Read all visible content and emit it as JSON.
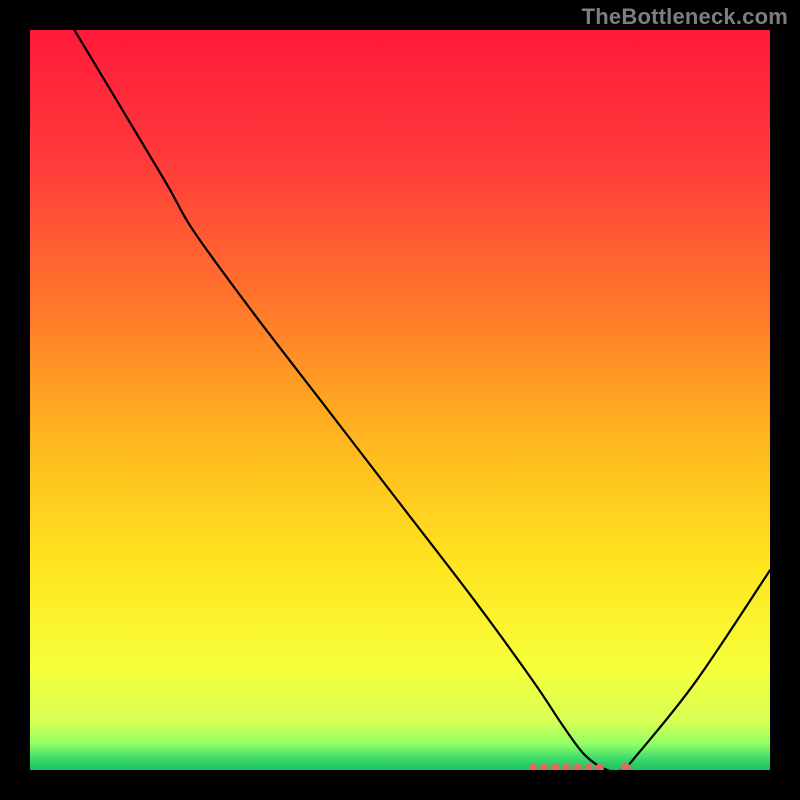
{
  "watermark": "TheBottleneck.com",
  "chart_data": {
    "type": "line",
    "title": "",
    "xlabel": "",
    "ylabel": "",
    "xlim": [
      0,
      100
    ],
    "ylim": [
      0,
      100
    ],
    "series": [
      {
        "name": "bottleneck-curve",
        "x": [
          0,
          6,
          18,
          22,
          30,
          40,
          50,
          60,
          68,
          72,
          75,
          78,
          80,
          82,
          90,
          100
        ],
        "y": [
          110,
          100,
          80,
          73,
          62,
          49,
          36,
          23,
          12,
          6,
          2,
          0,
          0,
          2,
          12,
          27
        ]
      }
    ],
    "markers": {
      "name": "optimal-range-dots",
      "x": [
        68.0,
        69.5,
        71.0,
        72.5,
        74.0,
        75.5,
        77.0,
        80.5
      ],
      "y": [
        0.3,
        0.3,
        0.3,
        0.3,
        0.3,
        0.3,
        0.3,
        0.3
      ]
    },
    "gradient_bands": [
      {
        "stop": 0.0,
        "color": "#ff1a3a"
      },
      {
        "stop": 0.18,
        "color": "#ff3b3b"
      },
      {
        "stop": 0.38,
        "color": "#ff7a2a"
      },
      {
        "stop": 0.55,
        "color": "#ffb51f"
      },
      {
        "stop": 0.72,
        "color": "#ffe41f"
      },
      {
        "stop": 0.86,
        "color": "#f6ff3a"
      },
      {
        "stop": 0.935,
        "color": "#d7ff55"
      },
      {
        "stop": 0.965,
        "color": "#8fff66"
      },
      {
        "stop": 0.985,
        "color": "#3bd96b"
      },
      {
        "stop": 1.0,
        "color": "#1fbf63"
      }
    ],
    "axes_visible": false
  }
}
